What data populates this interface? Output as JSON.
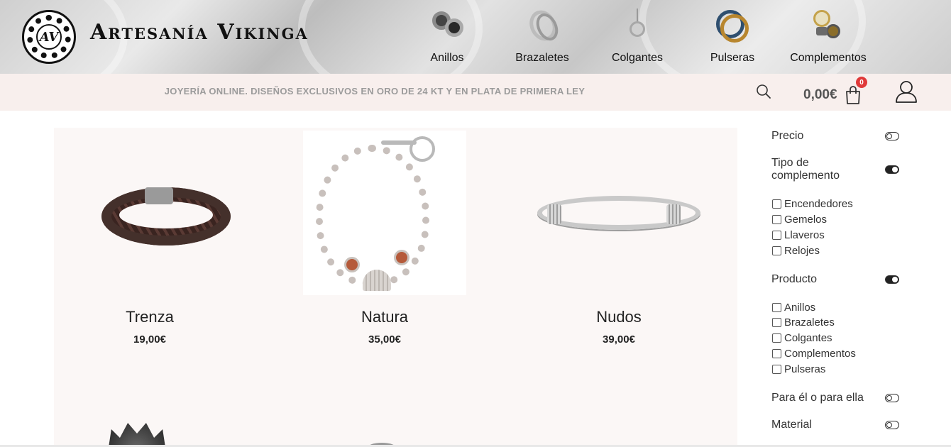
{
  "header": {
    "brand": "Artesanía Vikinga",
    "logo_letters": "AV"
  },
  "nav": {
    "items": [
      {
        "label": "Anillos",
        "icon": "rings-thumbnail"
      },
      {
        "label": "Brazaletes",
        "icon": "bangles-thumbnail"
      },
      {
        "label": "Colgantes",
        "icon": "pendant-thumbnail"
      },
      {
        "label": "Pulseras",
        "icon": "bracelets-thumbnail"
      },
      {
        "label": "Complementos",
        "icon": "accessories-thumbnail"
      }
    ]
  },
  "promo": {
    "text": "JOYERÍA ONLINE. DISEÑOS EXCLUSIVOS EN ORO DE 24 KT Y EN PLATA DE PRIMERA LEY"
  },
  "cart": {
    "total": "0,00€",
    "count": "0"
  },
  "products": [
    {
      "name": "Trenza",
      "price": "19,00€"
    },
    {
      "name": "Natura",
      "price": "35,00€"
    },
    {
      "name": "Nudos",
      "price": "39,00€"
    }
  ],
  "filters": {
    "precio": {
      "label": "Precio",
      "expanded": false
    },
    "tipo": {
      "label": "Tipo de complemento",
      "expanded": true,
      "options": [
        "Encendedores",
        "Gemelos",
        "Llaveros",
        "Relojes"
      ]
    },
    "producto": {
      "label": "Producto",
      "expanded": true,
      "options": [
        "Anillos",
        "Brazaletes",
        "Colgantes",
        "Complementos",
        "Pulseras"
      ]
    },
    "para": {
      "label": "Para él o para ella",
      "expanded": false
    },
    "material": {
      "label": "Material",
      "expanded": false
    }
  },
  "colors": {
    "promo_bg": "#f8efed",
    "badge": "#e03a3a",
    "promo_text": "#9b9b9b"
  }
}
